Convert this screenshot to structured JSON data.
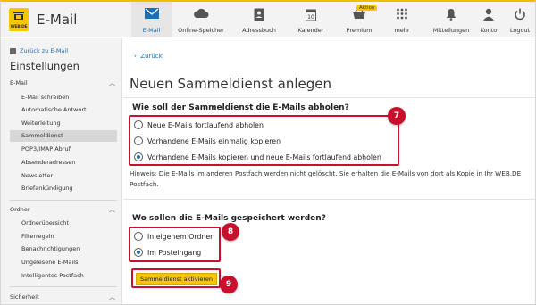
{
  "header": {
    "brand_small": "WEB.DE",
    "app_title": "E-Mail",
    "badge": "Aktion",
    "nav": [
      {
        "label": "E-Mail",
        "icon": "envelope-icon",
        "active": true
      },
      {
        "label": "Online-Speicher",
        "icon": "cloud-icon"
      },
      {
        "label": "Adressbuch",
        "icon": "addressbook-icon"
      },
      {
        "label": "Kalender",
        "icon": "calendar-icon",
        "day": "10"
      },
      {
        "label": "Premium",
        "icon": "basket-icon"
      },
      {
        "label": "mehr",
        "icon": "grid-icon"
      },
      {
        "label": "Mitteilungen",
        "icon": "bell-icon"
      },
      {
        "label": "Konto",
        "icon": "user-icon"
      },
      {
        "label": "Logout",
        "icon": "power-icon"
      }
    ]
  },
  "sidebar": {
    "back_link": "Zurück zu E-Mail",
    "title": "Einstellungen",
    "sections": [
      {
        "label": "E-Mail",
        "items": [
          "E-Mail schreiben",
          "Automatische Antwort",
          "Weiterleitung",
          "Sammeldienst",
          "POP3/IMAP Abruf",
          "Absenderadressen",
          "Newsletter",
          "Briefankündigung"
        ]
      },
      {
        "label": "Ordner",
        "items": [
          "Ordnerübersicht",
          "Filterregeln",
          "Benachrichtigungen",
          "Ungelesene E-Mails",
          "Intelligentes Postfach"
        ]
      },
      {
        "label": "Sicherheit",
        "items": []
      }
    ],
    "active_item": "Sammeldienst"
  },
  "main": {
    "back": "Zurück",
    "title": "Neuen Sammeldienst anlegen",
    "question1": "Wie soll der Sammeldienst die E-Mails abholen?",
    "options1": [
      {
        "label": "Neue E-Mails fortlaufend abholen",
        "selected": false
      },
      {
        "label": "Vorhandene E-Mails einmalig kopieren",
        "selected": false
      },
      {
        "label": "Vorhandene E-Mails kopieren und neue E-Mails fortlaufend abholen",
        "selected": true
      }
    ],
    "hint": "Hinweis: Die E-Mails im anderen Postfach werden nicht gelöscht. Sie erhalten die E-Mails von dort als Kopie in Ihr WEB.DE Postfach.",
    "question2": "Wo sollen die E-Mails gespeichert werden?",
    "options2": [
      {
        "label": "In eigenem Ordner",
        "selected": false
      },
      {
        "label": "Im Posteingang",
        "selected": true
      }
    ],
    "submit": "Sammeldienst aktivieren",
    "steps": [
      "7",
      "8",
      "9"
    ]
  },
  "colors": {
    "accent": "#1a6fb5",
    "brand_yellow": "#f7c600",
    "highlight_red": "#c8102e"
  }
}
